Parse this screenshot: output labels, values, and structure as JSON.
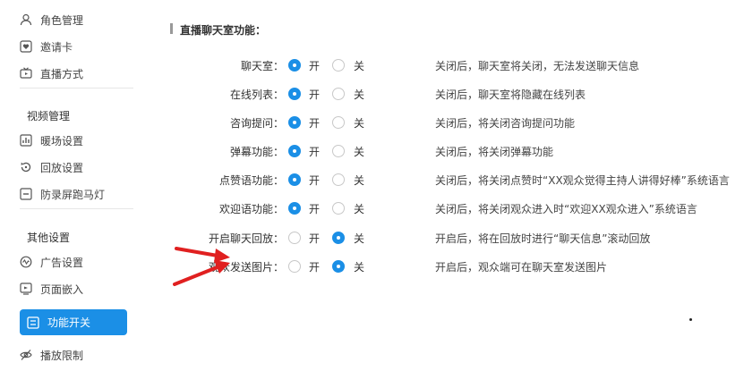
{
  "sidebar": {
    "top_items": [
      {
        "label": "角色管理",
        "icon": "user-icon"
      },
      {
        "label": "邀请卡",
        "icon": "invite-card-icon"
      },
      {
        "label": "直播方式",
        "icon": "tv-icon"
      }
    ],
    "video_section": "视频管理",
    "video_items": [
      {
        "label": "暖场设置",
        "icon": "chart-icon"
      },
      {
        "label": "回放设置",
        "icon": "replay-icon"
      },
      {
        "label": "防录屏跑马灯",
        "icon": "marquee-icon"
      }
    ],
    "other_section": "其他设置",
    "other_items": [
      {
        "label": "广告设置",
        "icon": "ad-icon"
      },
      {
        "label": "页面嵌入",
        "icon": "embed-icon"
      }
    ],
    "active_item": {
      "label": "功能开关",
      "icon": "switch-icon"
    },
    "bottom_item": {
      "label": "播放限制",
      "icon": "eye-slash-icon"
    }
  },
  "main": {
    "title": "直播聊天室功能：",
    "on_label": "开",
    "off_label": "关",
    "rows": [
      {
        "label": "聊天室：",
        "state": "on",
        "desc": "关闭后，聊天室将关闭，无法发送聊天信息"
      },
      {
        "label": "在线列表：",
        "state": "on",
        "desc": "关闭后，聊天室将隐藏在线列表"
      },
      {
        "label": "咨询提问：",
        "state": "on",
        "desc": "关闭后，将关闭咨询提问功能"
      },
      {
        "label": "弹幕功能：",
        "state": "on",
        "desc": "关闭后，将关闭弹幕功能"
      },
      {
        "label": "点赞语功能：",
        "state": "on",
        "desc": "关闭后，将关闭点赞时“XX观众觉得主持人讲得好棒”系统语言"
      },
      {
        "label": "欢迎语功能：",
        "state": "on",
        "desc": "关闭后，将关闭观众进入时“欢迎XX观众进入”系统语言"
      },
      {
        "label": "开启聊天回放：",
        "state": "off",
        "desc": "开启后，将在回放时进行“聊天信息”滚动回放"
      },
      {
        "label": "观众发送图片：",
        "state": "off",
        "desc": "开启后，观众端可在聊天室发送图片"
      }
    ]
  },
  "colors": {
    "accent": "#1b8fe6",
    "arrow": "#e02020"
  }
}
